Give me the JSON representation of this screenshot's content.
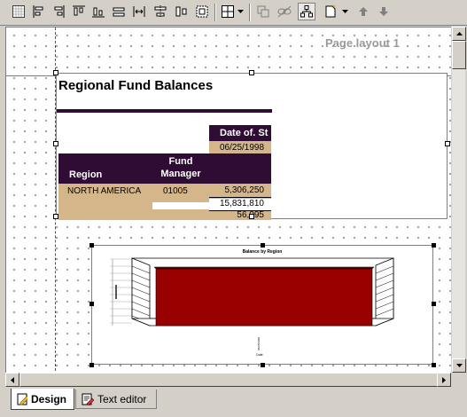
{
  "toolbar": {
    "icons": [
      "grid-icon",
      "align-left-icon",
      "align-right-icon",
      "align-top-icon",
      "align-bottom-icon",
      "make-same-width-icon",
      "make-same-height-icon",
      "center-vertically-icon",
      "make-same-size-icon",
      "grid-settings-icon",
      "bring-forward-icon",
      "link-icon",
      "hierarchy-icon",
      "new-item-icon",
      "move-up-icon",
      "move-down-icon"
    ]
  },
  "designer": {
    "page_label": "Page layout 1",
    "report_title": "Regional Fund Balances",
    "date_header": "Date of. St",
    "date_value": "06/25/1998",
    "col_region": "Region",
    "col_fund_manager_line1": "Fund",
    "col_fund_manager_line2": "Manager",
    "row_region": "NORTH AMERICA",
    "row_manager": "01005",
    "values": [
      "5,306,250",
      "15,831,810",
      "56,095"
    ],
    "chart": {
      "title": "Balance by Region",
      "x_axis_label": "Date",
      "x_tick": "06/25/1998"
    }
  },
  "colors": {
    "header_bg": "#2e0c34",
    "tan": "#d5b68a",
    "bar": "#990000"
  },
  "chart_data": {
    "type": "bar",
    "title": "Balance by Region",
    "xlabel": "Date",
    "ylabel": "",
    "categories": [
      "06/25/1998"
    ],
    "values": [
      1
    ]
  },
  "tabs": [
    {
      "label": "Design",
      "active": true
    },
    {
      "label": "Text editor",
      "active": false
    }
  ]
}
